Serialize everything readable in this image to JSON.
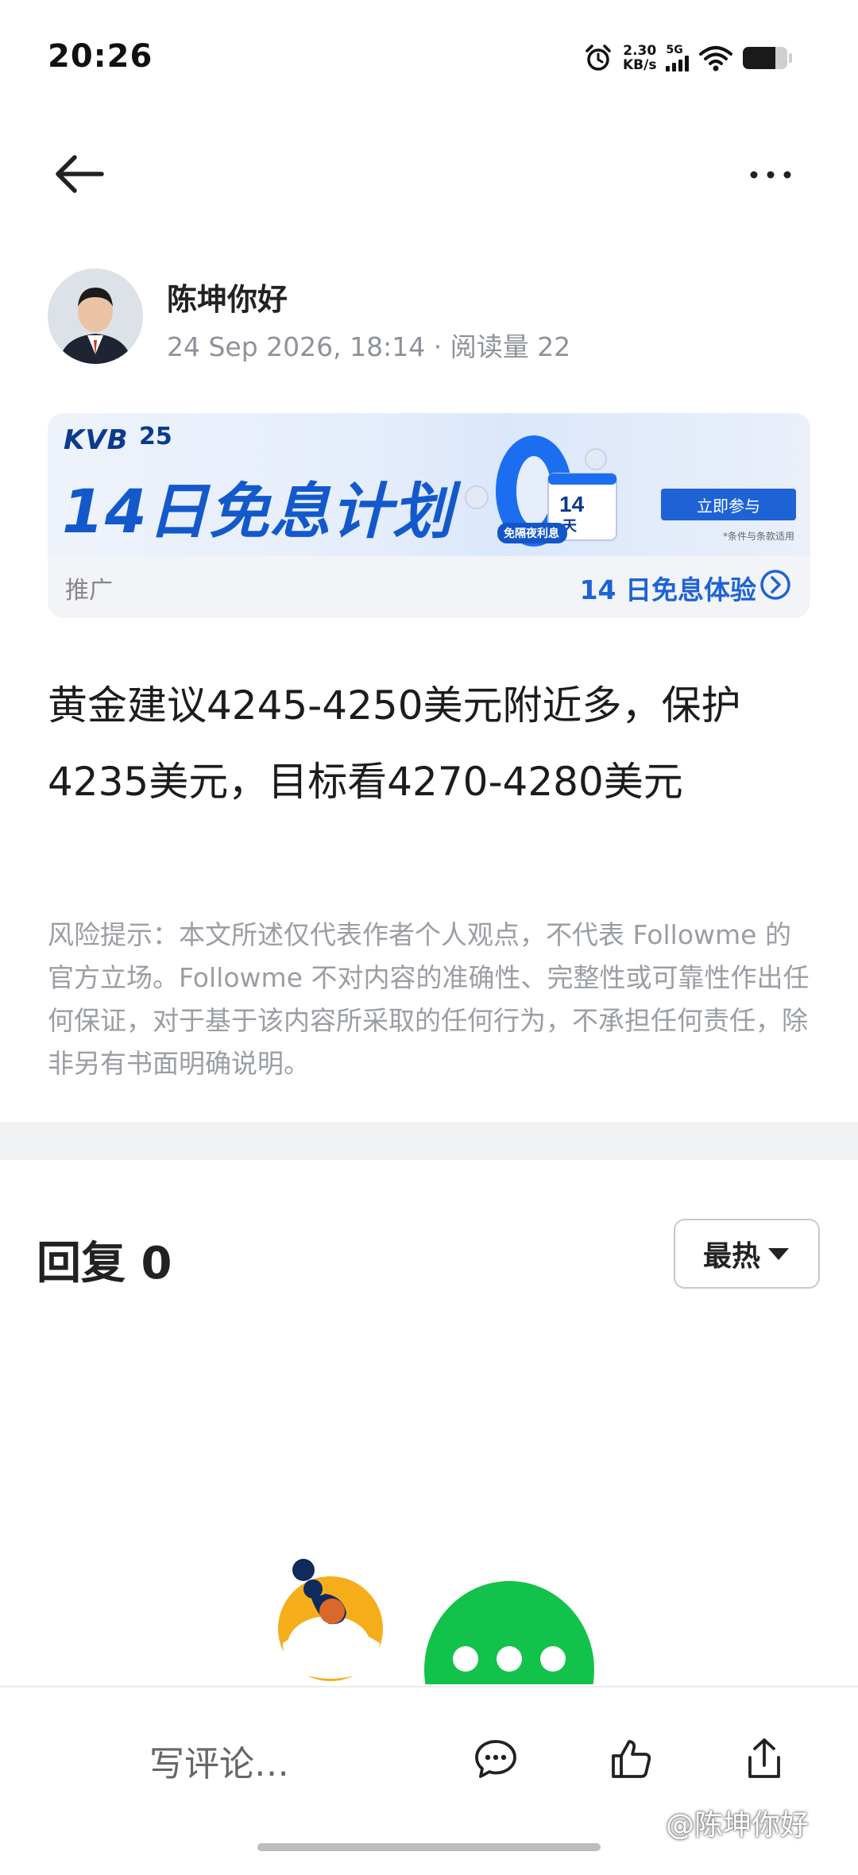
{
  "status_bar": {
    "time": "20:26",
    "net_speed_value": "2.30",
    "net_speed_unit": "KB/s",
    "network": "5G",
    "battery_level": 0.72,
    "icons": [
      "alarm-icon",
      "signal-icon",
      "wifi-icon",
      "battery-icon"
    ]
  },
  "header": {
    "back_icon": "arrow-left-icon",
    "more_icon": "more-dots-icon"
  },
  "author": {
    "name": "陈坤你好",
    "meta": "24 Sep 2026, 18:14 · 阅读量 22"
  },
  "promo": {
    "brand": "KVB",
    "years": "25",
    "headline": "14日免息计划",
    "cta": "立即参与",
    "terms": "*条件与条款适用",
    "badge_day": "14",
    "badge_unit": "天",
    "badge_label": "免隔夜利息",
    "label": "推广",
    "link": "14 日免息体验"
  },
  "post": {
    "body": "黄金建议4245-4250美元附近多，保护4235美元，目标看4270-4280美元",
    "disclaimer": "风险提示：本文所述仅代表作者个人观点，不代表 Followme 的官方立场。Followme 不对内容的准确性、完整性或可靠性作出任何保证，对于基于该内容所采取的任何行为，不承担任何责任，除非另有书面明确说明。"
  },
  "replies": {
    "title": "回复 0",
    "sort_label": "最热"
  },
  "bottom_bar": {
    "comment_placeholder": "写评论…",
    "icons": [
      "comment-icon",
      "like-icon",
      "share-icon"
    ]
  },
  "watermark": "@陈坤你好",
  "colors": {
    "accent": "#1e63d6",
    "muted_text": "#9a9ea4",
    "divider": "#f0f1f3",
    "sticker_green": "#13c24a",
    "sticker_yellow": "#f5ad1a"
  }
}
